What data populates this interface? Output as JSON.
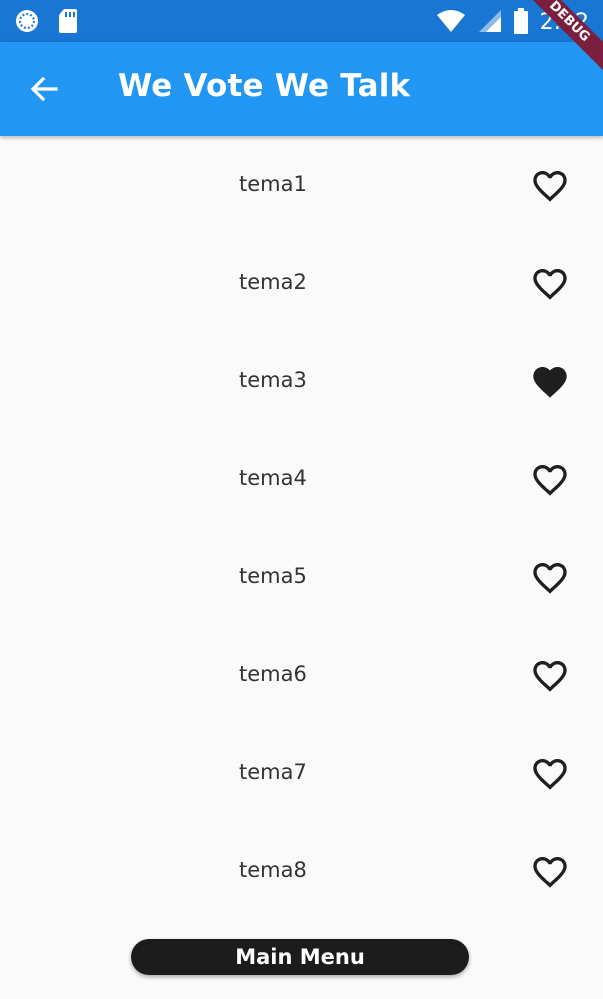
{
  "status_bar": {
    "time": "2:22",
    "icons": [
      "sync-icon",
      "sd-card-icon",
      "wifi-icon",
      "signal-icon",
      "battery-icon"
    ]
  },
  "app_bar": {
    "title": "We Vote We Talk",
    "back_icon": "arrow-back-icon"
  },
  "debug_banner": {
    "label": "DEBUG",
    "color": "#7a1f3d"
  },
  "topics": [
    {
      "label": "tema1",
      "liked": false
    },
    {
      "label": "tema2",
      "liked": false
    },
    {
      "label": "tema3",
      "liked": true
    },
    {
      "label": "tema4",
      "liked": false
    },
    {
      "label": "tema5",
      "liked": false
    },
    {
      "label": "tema6",
      "liked": false
    },
    {
      "label": "tema7",
      "liked": false
    },
    {
      "label": "tema8",
      "liked": false
    }
  ],
  "footer": {
    "main_menu_label": "Main Menu"
  },
  "colors": {
    "status_bar": "#1976d2",
    "app_bar": "#2196f3",
    "background": "#fafafa",
    "button": "#1c1c1c"
  }
}
